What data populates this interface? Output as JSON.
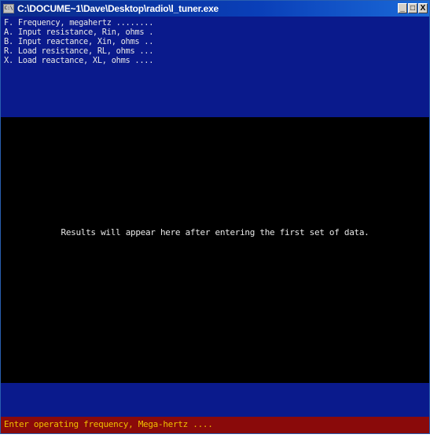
{
  "window": {
    "title": "C:\\DOCUME~1\\Dave\\Desktop\\radio\\l_tuner.exe",
    "icon_text": "C:\\",
    "controls": {
      "minimize": "_",
      "maximize": "□",
      "close": "X"
    }
  },
  "menu": {
    "lines": [
      "F. Frequency, megahertz ........",
      "A. Input resistance, Rin, ohms .",
      "B. Input reactance, Xin, ohms ..",
      "R. Load resistance, RL, ohms ...",
      "X. Load reactance, XL, ohms ...."
    ]
  },
  "results": {
    "message": "Results will appear here after entering the first set of data."
  },
  "prompt": {
    "text": "Enter operating frequency, Mega-hertz ...."
  },
  "colors": {
    "console_bg": "#000000",
    "menu_bg": "#0a1a8c",
    "prompt_bg": "#8a0a0a",
    "prompt_fg": "#f0c000",
    "text_fg": "#e8e8e8"
  }
}
